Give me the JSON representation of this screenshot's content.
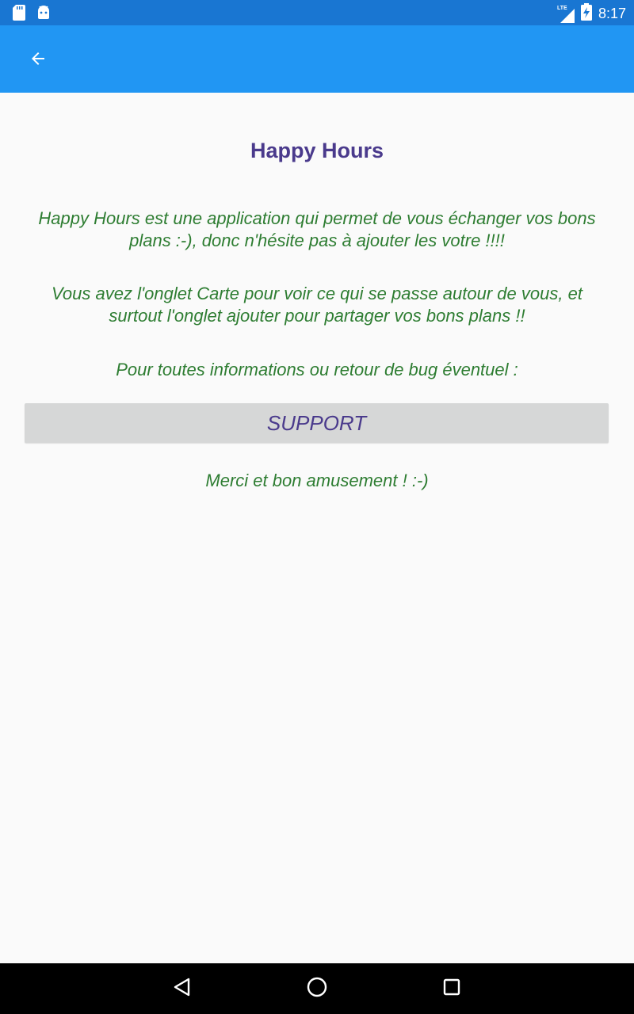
{
  "status_bar": {
    "time": "8:17",
    "network": "LTE",
    "icons": [
      "sd-card-icon",
      "android-icon",
      "signal-icon",
      "battery-charging-icon"
    ]
  },
  "app_bar": {
    "back_icon": "arrow-back-icon"
  },
  "content": {
    "title": "Happy Hours",
    "paragraph1": "Happy Hours est une application qui permet de vous échanger vos bons plans :-), donc n'hésite pas à ajouter les votre !!!!",
    "paragraph2": "Vous avez l'onglet Carte pour voir ce qui se passe autour de vous, et surtout l'onglet ajouter pour partager vos bons plans !!",
    "paragraph3": "Pour toutes informations ou retour de bug éventuel :",
    "support_button": "SUPPORT",
    "closing": "Merci et bon amusement ! :-)"
  },
  "colors": {
    "status_bar": "#1976d2",
    "app_bar": "#2196f3",
    "title": "#4a3a8c",
    "text_green": "#2e7d32",
    "button_bg": "#d6d7d7"
  },
  "nav_bar": {
    "icons": [
      "nav-back-icon",
      "nav-home-icon",
      "nav-recents-icon"
    ]
  }
}
